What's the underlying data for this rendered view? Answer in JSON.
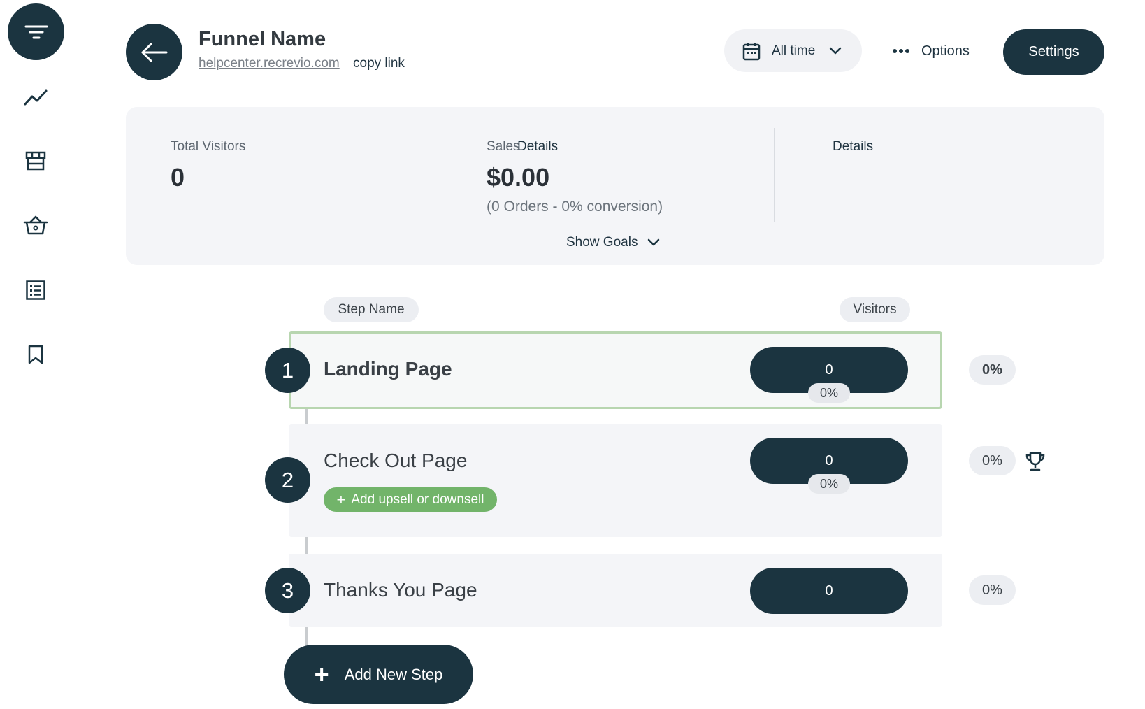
{
  "sidebar": {
    "items": [
      {
        "icon": "funnel-icon",
        "active": true
      },
      {
        "icon": "trend-chart-icon"
      },
      {
        "icon": "store-icon"
      },
      {
        "icon": "basket-icon"
      },
      {
        "icon": "list-icon"
      },
      {
        "icon": "bookmark-icon"
      }
    ]
  },
  "header": {
    "title": "Funnel Name",
    "url": "helpcenter.recrevio.com",
    "copy_link": "copy link",
    "date_range": "All time",
    "options_label": "Options",
    "settings_label": "Settings"
  },
  "stats": {
    "visitors": {
      "label": "Total Visitors",
      "details": "Details",
      "value": "0"
    },
    "sales": {
      "label": "Sales",
      "details": "Details",
      "value": "$0.00",
      "sub": "(0 Orders - 0% conversion)"
    },
    "show_goals": "Show Goals"
  },
  "columns": {
    "step_name": "Step Name",
    "visitors": "Visitors"
  },
  "steps": [
    {
      "number": "1",
      "name": "Landing Page",
      "visitors": "0",
      "bar_pct": "0%",
      "side_pct": "0%"
    },
    {
      "number": "2",
      "name": "Check Out Page",
      "visitors": "0",
      "bar_pct": "0%",
      "side_pct": "0%",
      "upsell": "Add upsell or downsell"
    },
    {
      "number": "3",
      "name": "Thanks You Page",
      "visitors": "0",
      "side_pct": "0%"
    }
  ],
  "add_step": "Add New Step",
  "colors": {
    "primary": "#1b3440",
    "accent_green": "#72b46a",
    "panel": "#f4f5f8"
  }
}
